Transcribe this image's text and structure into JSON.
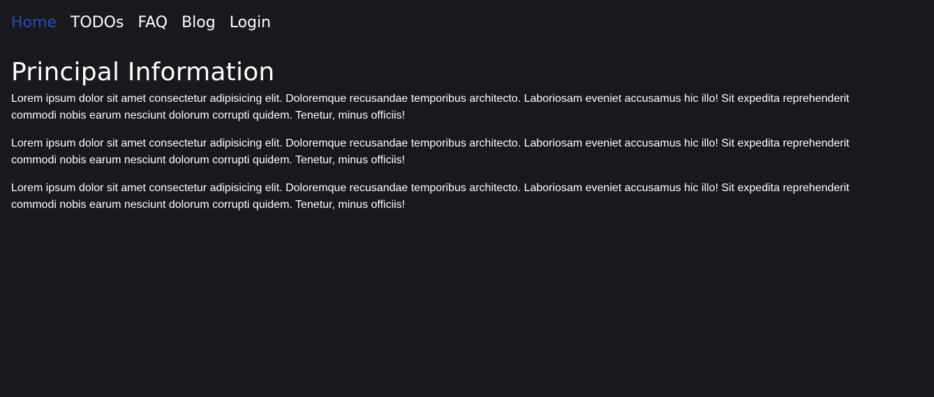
{
  "colors": {
    "background": "#18181d",
    "text": "#ffffff",
    "active_link": "#2c49b8"
  },
  "nav": {
    "items": [
      {
        "label": "Home",
        "active": true
      },
      {
        "label": "TODOs",
        "active": false
      },
      {
        "label": "FAQ",
        "active": false
      },
      {
        "label": "Blog",
        "active": false
      },
      {
        "label": "Login",
        "active": false
      }
    ]
  },
  "main": {
    "title": "Principal Information",
    "paragraphs": [
      "Lorem ipsum dolor sit amet consectetur adipisicing elit. Doloremque recusandae temporibus architecto. Laboriosam eveniet accusamus hic illo! Sit expedita reprehenderit commodi nobis earum nesciunt dolorum corrupti quidem. Tenetur, minus officiis!",
      "Lorem ipsum dolor sit amet consectetur adipisicing elit. Doloremque recusandae temporibus architecto. Laboriosam eveniet accusamus hic illo! Sit expedita reprehenderit commodi nobis earum nesciunt dolorum corrupti quidem. Tenetur, minus officiis!",
      "Lorem ipsum dolor sit amet consectetur adipisicing elit. Doloremque recusandae temporibus architecto. Laboriosam eveniet accusamus hic illo! Sit expedita reprehenderit commodi nobis earum nesciunt dolorum corrupti quidem. Tenetur, minus officiis!"
    ]
  }
}
